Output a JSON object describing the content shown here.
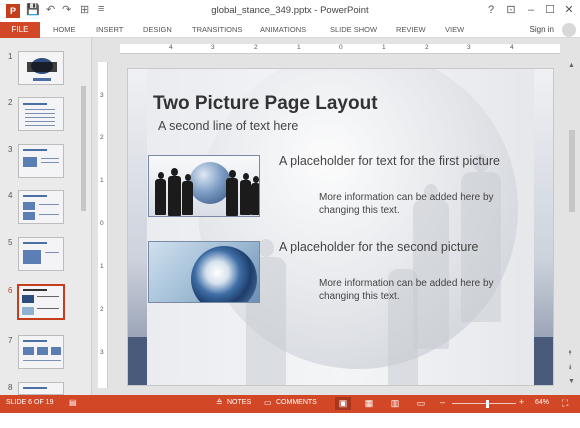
{
  "window": {
    "title": "global_stance_349.pptx - PowerPoint",
    "app_icon": "P",
    "help": "?",
    "ribbon_display": "⊡",
    "minimize": "–",
    "restore": "☐",
    "close": "✕"
  },
  "quick_access": {
    "save_icon": "💾",
    "undo_icon": "↶",
    "redo_icon": "↷",
    "start_from_beginning_icon": "⊞",
    "customize_icon": "≡"
  },
  "ribbon": {
    "tabs": [
      "FILE",
      "HOME",
      "INSERT",
      "DESIGN",
      "TRANSITIONS",
      "ANIMATIONS",
      "SLIDE SHOW",
      "REVIEW",
      "VIEW"
    ],
    "sign_in": "Sign in"
  },
  "thumbnails": {
    "numbers": [
      "1",
      "2",
      "3",
      "4",
      "5",
      "6",
      "7",
      "8"
    ],
    "active_index": 6
  },
  "rulers": {
    "horizontal": [
      "4",
      "3",
      "2",
      "1",
      "0",
      "1",
      "2",
      "3",
      "4"
    ],
    "vertical": [
      "3",
      "2",
      "1",
      "0",
      "1",
      "2",
      "3"
    ]
  },
  "slide": {
    "title": "Two Picture Page Layout",
    "subtitle": "A second line of text here",
    "placeholder1": "A placeholder for text for the first picture",
    "info1": "More information can be added here by changing this text.",
    "placeholder2": "A placeholder for the second picture",
    "info2": "More information can be added here by changing this text."
  },
  "status": {
    "slide_info": "SLIDE 6 OF 19",
    "notes": "NOTES",
    "comments": "COMMENTS",
    "zoom_minus": "–",
    "zoom_plus": "+",
    "zoom": "64%"
  },
  "colors": {
    "accent": "#d24726",
    "title_text": "#333333"
  }
}
